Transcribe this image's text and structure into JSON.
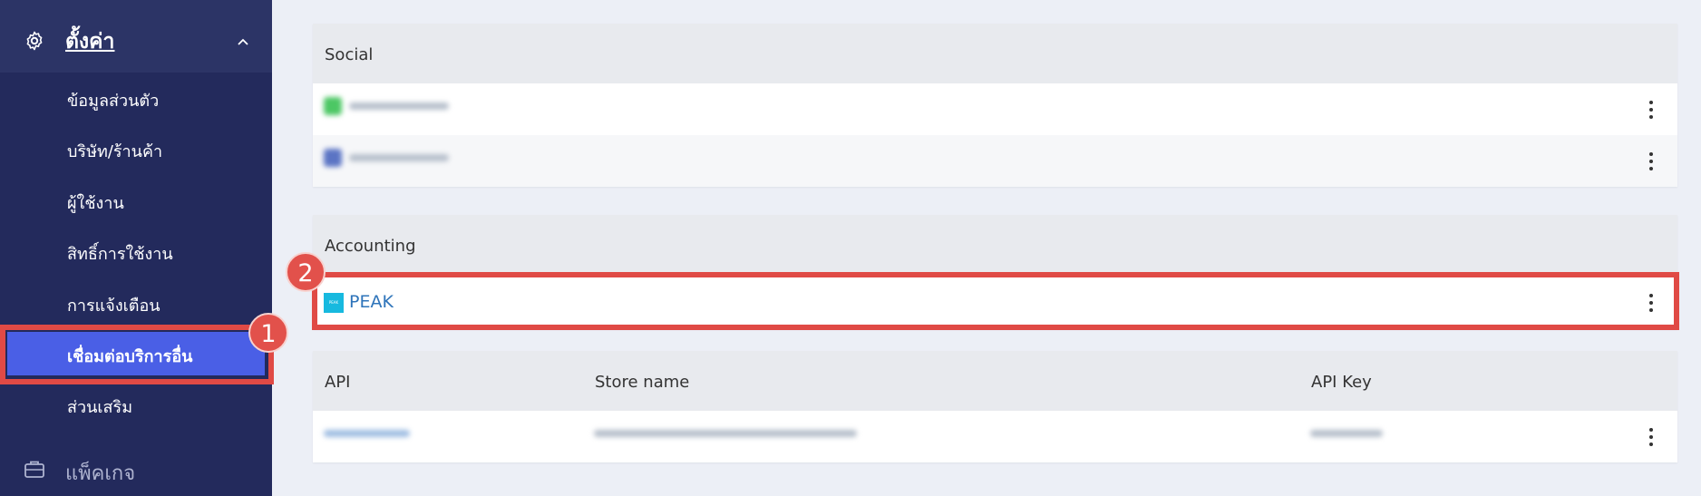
{
  "sidebar": {
    "settings_title": "ตั้งค่า",
    "items": [
      {
        "label": "ข้อมูลส่วนตัว"
      },
      {
        "label": "บริษัท/ร้านค้า"
      },
      {
        "label": "ผู้ใช้งาน"
      },
      {
        "label": "สิทธิ์การใช้งาน"
      },
      {
        "label": "การแจ้งเตือน"
      },
      {
        "label": "เชื่อมต่อบริการอื่น",
        "active": true
      },
      {
        "label": "ส่วนเสริม"
      }
    ],
    "package_label": "แพ็คเกจ"
  },
  "sections": {
    "social": {
      "title": "Social",
      "rows": [
        {
          "icon_color": "#4cc764",
          "redacted": true
        },
        {
          "icon_color": "#5b74c4",
          "redacted": true
        }
      ]
    },
    "accounting": {
      "title": "Accounting",
      "rows": [
        {
          "name": "PEAK",
          "logo_text": "PEAK",
          "logo_color": "#17b9df"
        }
      ]
    },
    "api": {
      "columns": [
        "API",
        "Store name",
        "API Key"
      ],
      "rows": [
        {
          "redacted": true
        }
      ]
    }
  },
  "annotations": {
    "step1": "1",
    "step2": "2",
    "highlight_color": "#e04a45"
  },
  "colors": {
    "sidebar_bg": "#232a5c",
    "active_item": "#4a5fe6",
    "link_blue": "#2e74ba"
  }
}
